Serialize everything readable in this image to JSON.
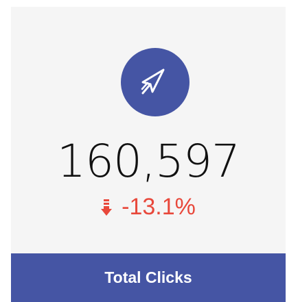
{
  "card": {
    "icon": "cursor-arrow-icon",
    "value": "160,597",
    "change": {
      "direction": "down",
      "icon": "arrow-down-icon",
      "text": "-13.1%"
    },
    "label": "Total Clicks"
  },
  "colors": {
    "accent": "#4555a4",
    "negative": "#e8483b",
    "card_background": "#f5f5f5",
    "value_text": "#111111"
  }
}
